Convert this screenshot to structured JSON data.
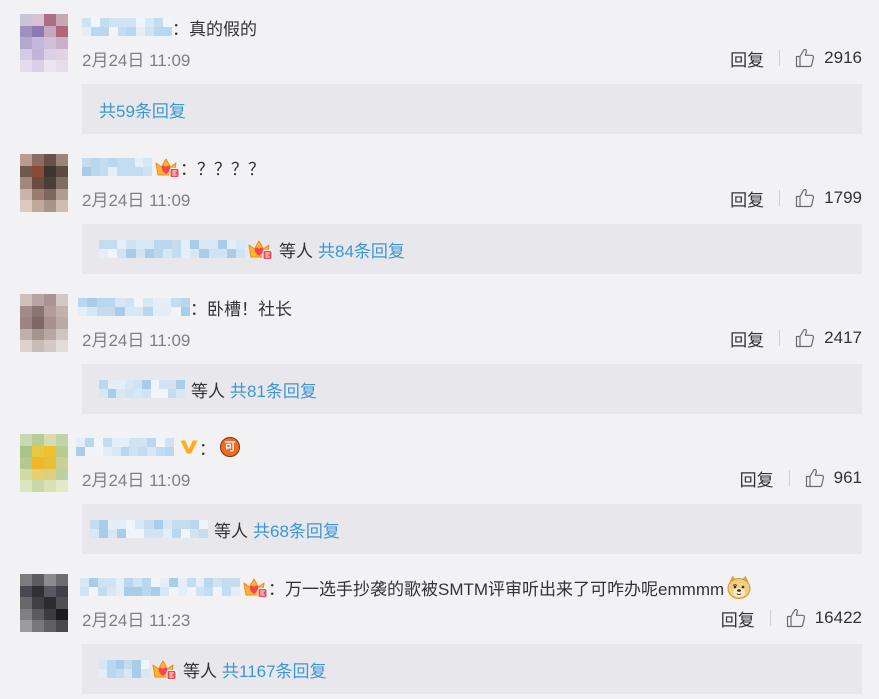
{
  "theme": {
    "page_background": "#f2f2f5",
    "reply_box_background": "#e8e8ec",
    "link_color": "#3c96d4",
    "text_color": "#333333",
    "meta_color": "#808080",
    "username_blur_palette": [
      "#cfe3f3",
      "#b9d7ee",
      "#e3eef8",
      "#a9cde9",
      "#d6e8f5",
      "#f0f5fb",
      "#c3dcf0"
    ]
  },
  "comments": [
    {
      "avatar": {
        "cells": [
          [
            "#c9c3dc",
            "#d6c2d4",
            "#a87080",
            "#c8a8b4"
          ],
          [
            "#9e90bf",
            "#8a7ab0",
            "#c4a8c0",
            "#b06878"
          ],
          [
            "#b4a8d0",
            "#c6b8dc",
            "#d0c0d8",
            "#c8b0c8"
          ],
          [
            "#d4cce4",
            "#c0b4d8",
            "#dcd0e4",
            "#e0d4e4"
          ],
          [
            "#e4dcec",
            "#d8d0e6",
            "#ece4f0",
            "#e6dcea"
          ]
        ]
      },
      "username_badge": null,
      "text": "：真的假的",
      "time": "2月24日 11:09",
      "reply_label": "回复",
      "like_icon": "thumbs-up-icon",
      "like_count": "2916",
      "replies": {
        "total_label": "共59条回复"
      }
    },
    {
      "avatar": {
        "cells": [
          [
            "#b89c90",
            "#8c6c60",
            "#6a5048",
            "#9c8478"
          ],
          [
            "#70584c",
            "#8a4a38",
            "#3e3430",
            "#5c4c44"
          ],
          [
            "#a0887c",
            "#6c4c40",
            "#4a3e38",
            "#806c60"
          ],
          [
            "#c8b4a8",
            "#9c7c70",
            "#7c6860",
            "#b09c90"
          ],
          [
            "#dccac0",
            "#c0a89c",
            "#a89488",
            "#d0bcb0"
          ]
        ]
      },
      "username_badge": "fan-crown-badge-icon",
      "text": "：？？？？",
      "time": "2月24日 11:09",
      "reply_label": "回复",
      "like_icon": "thumbs-up-icon",
      "like_count": "1799",
      "replies": {
        "repliers_badge": "fan-crown-badge-icon",
        "others_label": "等人",
        "total_label": "共84条回复"
      }
    },
    {
      "avatar": {
        "cells": [
          [
            "#cfc0bc",
            "#b8a4a0",
            "#a89494",
            "#d4c8c4"
          ],
          [
            "#a08c88",
            "#8c7470",
            "#b49c98",
            "#c4b0ac"
          ],
          [
            "#9c8480",
            "#7c6864",
            "#a8908c",
            "#bca8a4"
          ],
          [
            "#c0b0ac",
            "#a4948c",
            "#b8a8a4",
            "#d0c4c0"
          ],
          [
            "#ddd2ce",
            "#c8bcb8",
            "#d4c8c4",
            "#e4dcd8"
          ]
        ]
      },
      "username_badge": null,
      "text": "：卧槽！社长",
      "time": "2月24日 11:09",
      "reply_label": "回复",
      "like_icon": "thumbs-up-icon",
      "like_count": "2417",
      "replies": {
        "others_label": "等人",
        "total_label": "共81条回复"
      }
    },
    {
      "avatar": {
        "cells": [
          [
            "#c8d8b0",
            "#b8cc98",
            "#d4dcb0",
            "#c0d4a8"
          ],
          [
            "#a8c488",
            "#e8c840",
            "#f0c030",
            "#b8cc90"
          ],
          [
            "#b4c890",
            "#f0b828",
            "#e8c038",
            "#c8d098"
          ],
          [
            "#d0dca8",
            "#e4d070",
            "#dcd080",
            "#bcd0a0"
          ],
          [
            "#dce4c0",
            "#c8d8a8",
            "#d8e0b4",
            "#e4e8c8"
          ]
        ]
      },
      "username_badge": "verified-v-badge-icon",
      "text": "：",
      "emoji": {
        "icon": "ke-emoji-icon",
        "char": "可"
      },
      "time": "2月24日 11:09",
      "reply_label": "回复",
      "like_icon": "thumbs-up-icon",
      "like_count": "961",
      "replies": {
        "others_label": "等人",
        "total_label": "共68条回复"
      }
    },
    {
      "avatar": {
        "cells": [
          [
            "#7c7c80",
            "#5c5c60",
            "#8c8c90",
            "#6c6c70"
          ],
          [
            "#484850",
            "#303034",
            "#585860",
            "#40404a"
          ],
          [
            "#68686c",
            "#404044",
            "#2c2c30",
            "#505054"
          ],
          [
            "#808084",
            "#5c5c60",
            "#3c3c40",
            "#1c1c20"
          ],
          [
            "#9c9ca0",
            "#78787c",
            "#606064",
            "#48484c"
          ]
        ]
      },
      "username_badge": "fan-crown-badge-icon",
      "text": "：万一选手抄袭的歌被SMTM评审听出来了可咋办呢emmmm",
      "emoji": {
        "icon": "doge-emoji-icon"
      },
      "time": "2月24日 11:23",
      "reply_label": "回复",
      "like_icon": "thumbs-up-icon",
      "like_count": "16422",
      "replies": {
        "repliers_badge": "fan-crown-badge-icon",
        "others_label": "等人",
        "total_label": "共1167条回复"
      }
    }
  ]
}
